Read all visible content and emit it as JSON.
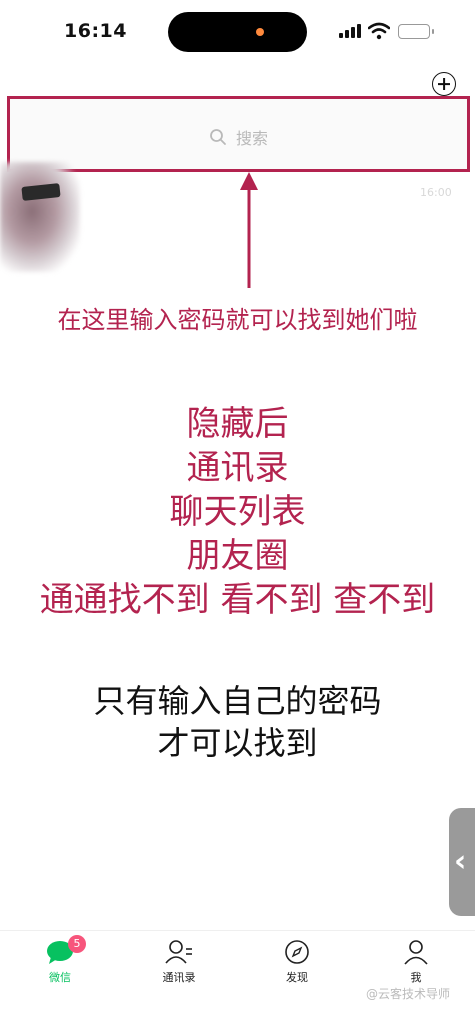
{
  "status_bar": {
    "time": "16:14"
  },
  "search": {
    "placeholder": "搜索"
  },
  "chat_preview": {
    "time": "16:00"
  },
  "annotations": {
    "hint_top": "在这里输入密码就可以找到她们啦",
    "hidden_lines": [
      "隐藏后",
      "通讯录",
      "聊天列表",
      "朋友圈",
      "通通找不到 看不到 查不到"
    ],
    "note_lines": [
      "只有输入自己的密码",
      "才可以找到"
    ]
  },
  "edge_handle": {
    "glyph": "‹"
  },
  "tab_bar": {
    "chats_label": "微信",
    "chats_badge": "5",
    "contacts_label": "通讯录",
    "discover_label": "发现",
    "me_label": "我"
  },
  "watermark": "@云客技术导师",
  "colors": {
    "annotation": "#b3234f",
    "active_tab": "#07c160",
    "badge": "#f7557c"
  },
  "icons": [
    "plus-circle-icon",
    "search-icon",
    "chat-bubble-icon",
    "contacts-icon",
    "compass-icon",
    "person-icon"
  ]
}
